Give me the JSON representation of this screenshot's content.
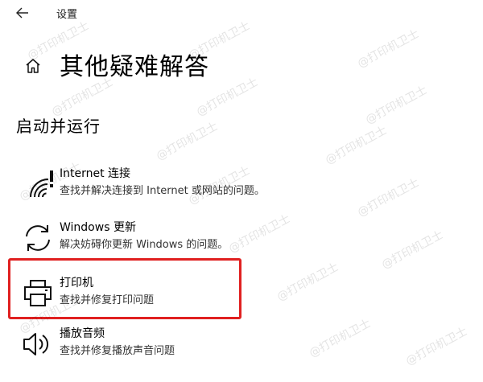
{
  "window": {
    "title": "设置",
    "back_icon": "back-arrow-icon"
  },
  "page": {
    "home_icon": "home-icon",
    "title": "其他疑难解答",
    "section_title": "启动并运行"
  },
  "items": [
    {
      "icon": "wifi-icon",
      "name": "Internet 连接",
      "desc": "查找并解决连接到 Internet 或网站的问题。"
    },
    {
      "icon": "refresh-icon",
      "name": "Windows 更新",
      "desc": "解决妨碍你更新 Windows 的问题。"
    },
    {
      "icon": "printer-icon",
      "name": "打印机",
      "desc": "查找并修复打印问题",
      "highlighted": true
    },
    {
      "icon": "speaker-icon",
      "name": "播放音频",
      "desc": "查找并修复播放声音问题"
    }
  ],
  "watermark": {
    "text": "@打印机卫士",
    "color": "#000000"
  },
  "colors": {
    "highlight_border": "#e02020",
    "background": "#ffffff"
  }
}
